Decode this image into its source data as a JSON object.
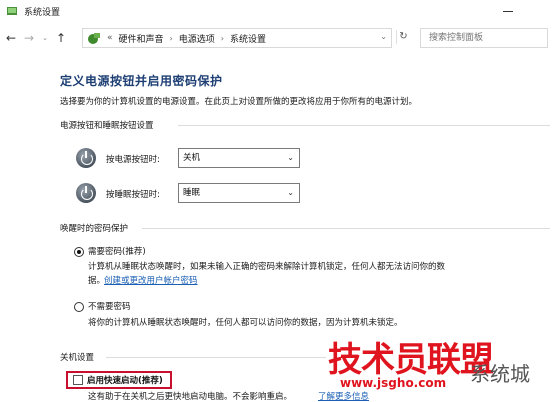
{
  "window": {
    "title": "系统设置"
  },
  "nav": {
    "back_glyph": "←",
    "forward_glyph": "→",
    "dropdown_glyph": "⌄",
    "up_glyph": "↑",
    "refresh_glyph": "↻"
  },
  "address": {
    "more": "«",
    "crumbs": [
      "硬件和声音",
      "电源选项",
      "系统设置"
    ],
    "separator": "›",
    "dropdown_glyph": "⌄"
  },
  "search": {
    "placeholder": "搜索控制面板"
  },
  "page": {
    "title": "定义电源按钮并启用密码保护",
    "description": "选择要为你的计算机设置的电源设置。在此页上对设置所做的更改将应用于你所有的电源计划。"
  },
  "power_section": {
    "label": "电源按钮和睡眠按钮设置",
    "rows": [
      {
        "label": "按电源按钮时:",
        "value": "关机",
        "icon": "power-icon"
      },
      {
        "label": "按睡眠按钮时:",
        "value": "睡眠",
        "icon": "sleep-icon"
      }
    ],
    "chevron": "⌄"
  },
  "password_section": {
    "label": "唤醒时的密码保护",
    "require": {
      "label": "需要密码(推荐)",
      "help": "计算机从睡眠状态唤醒时，如果未输入正确的密码来解除计算机锁定，任何人都无法访问你的数",
      "help2": "据。",
      "link": "创建或更改用户帐户密码",
      "checked": true
    },
    "no_require": {
      "label": "不需要密码",
      "help": "将你的计算机从睡眠状态唤醒时，任何人都可以访问你的数据，因为计算机未锁定。",
      "checked": false
    }
  },
  "shutdown_section": {
    "label": "关机设置",
    "fast_startup": {
      "label": "启用快速启动(推荐)",
      "checked": false,
      "help": "这有助于在关机之后更快地启动电脑。不会影响重启。",
      "link": "了解更多信息"
    }
  },
  "watermark": {
    "text": "技术员联盟",
    "url": "www.jsgho.com",
    "suffix": "系统城"
  },
  "colors": {
    "heading": "#1e3f74",
    "link": "#1a5fb4",
    "highlight": "#c8102e",
    "watermark": "#e0141e"
  }
}
